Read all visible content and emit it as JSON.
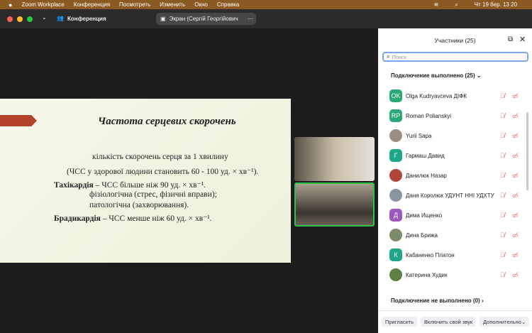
{
  "menubar": {
    "items": [
      "Zoom Workplace",
      "Конференция",
      "Посмотреть",
      "Изменить",
      "Окно",
      "Справка"
    ],
    "clock": "Чт 19 бер.  13 20"
  },
  "titlebar": {
    "meeting": "Конференция",
    "screen": "Экран (Сергій Георгійович"
  },
  "slide": {
    "title": "Частота серцевих скорочень",
    "lines": [
      "кількість скорочень серця за 1 хвилину",
      "(ЧСС у здорової людини становить 60 - 100 уд. × хв⁻¹).",
      "ЧСС більше ніж 90 уд. × хв⁻¹.",
      "фізіологічна (стрес, фізичні вправи);",
      "патологічна (захворювання).",
      "ЧСС менше ніж 60 уд. × хв⁻¹."
    ],
    "term1": "Тахікардія",
    "term2": "Брадикардія",
    "accent": "#b5432a"
  },
  "panel": {
    "title": "Участники (25)",
    "search_placeholder": "Поиск",
    "connected": "Подключение выполнено (25)",
    "not_connected": "Подключение не выполнено (0)",
    "participants": [
      {
        "initials": "OK",
        "name": "Olga Kudryavceva ДІФК",
        "color": "#2aa876"
      },
      {
        "initials": "RP",
        "name": "Roman Polianskyi",
        "color": "#2aa876"
      },
      {
        "initials": "",
        "name": "Yurii Sapa",
        "color": "#9a8f80"
      },
      {
        "initials": "Г",
        "name": "Гармаш Давид",
        "color": "#1fa78a"
      },
      {
        "initials": "",
        "name": "Данилюк Назар",
        "color": "#b0463a"
      },
      {
        "initials": "",
        "name": "Даня Королюк УДУНТ ННІ УДХТУ",
        "color": "#8a94a0"
      },
      {
        "initials": "Д",
        "name": "Дима Ищенко",
        "color": "#9b59c0"
      },
      {
        "initials": "",
        "name": "Дина Брижа",
        "color": "#7c8a6a"
      },
      {
        "initials": "К",
        "name": "Кабаненко Платон",
        "color": "#1fa78a"
      },
      {
        "initials": "",
        "name": "Катерина Худик",
        "color": "#5f8040"
      }
    ],
    "buttons": {
      "invite": "Пригласить",
      "unmute": "Включить свой звук",
      "more": "Дополнительно"
    }
  }
}
